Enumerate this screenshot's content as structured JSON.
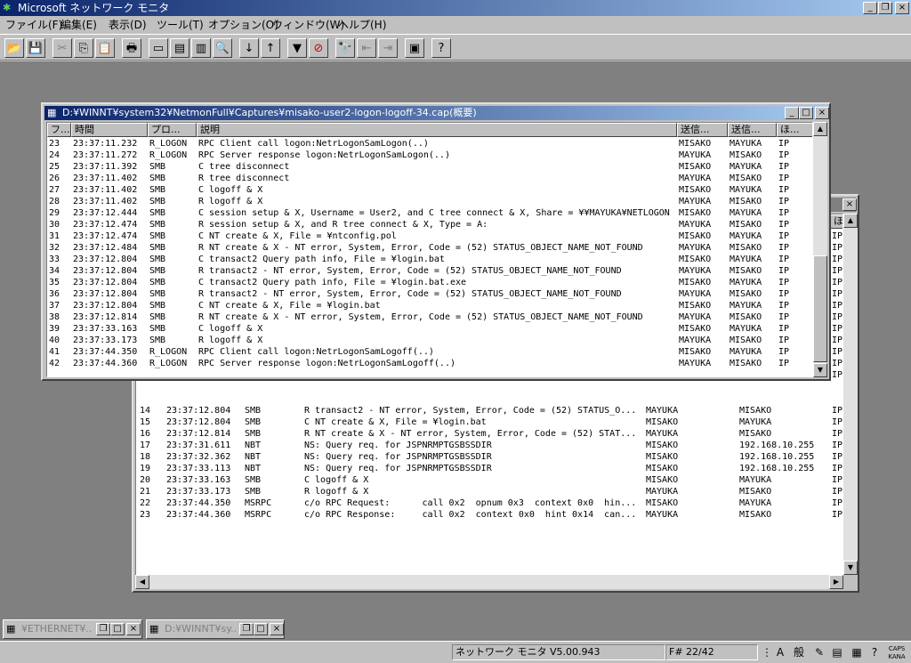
{
  "app": {
    "title": "Microsoft ネットワーク モニタ",
    "icon": "netmon-icon",
    "window_controls": [
      "_",
      "❐",
      "×"
    ]
  },
  "menu": [
    "ファイル(F)",
    "編集(E)",
    "表示(D)",
    "ツール(T)",
    "オプション(O)",
    "ウィンドウ(W)",
    "ヘルプ(H)"
  ],
  "toolbar_glyphs": {
    "open": "📂",
    "save": "💾",
    "cut": "✂",
    "copy": "⎘",
    "paste": "📋",
    "print": "🖶",
    "pane1": "▭",
    "pane2": "▤",
    "pane3": "▥",
    "zoom": "🔍",
    "down": "↓",
    "up": "↑",
    "filter": "▼",
    "nofilter": "⊘",
    "find": "🔭",
    "findprev": "⇤",
    "findnext": "⇥",
    "window": "▣",
    "help": "?"
  },
  "colors": {
    "titlebar_active": "#0a246a",
    "titlebar_inactive": "#808080",
    "workspace": "#808080"
  },
  "front_window": {
    "title": "D:¥WINNT¥system32¥NetmonFull¥Captures¥misako-user2-logon-logoff-34.cap(概要)",
    "columns": [
      "フ...",
      "時間",
      "プロ...",
      "説明",
      "送信...",
      "送信...",
      "ほ..."
    ],
    "rows": [
      [
        "23",
        "23:37:11.232",
        "R_LOGON",
        "RPC Client call logon:NetrLogonSamLogon(..)",
        "MISAKO",
        "MAYUKA",
        "IP"
      ],
      [
        "24",
        "23:37:11.272",
        "R_LOGON",
        "RPC Server response logon:NetrLogonSamLogon(..)",
        "MAYUKA",
        "MISAKO",
        "IP"
      ],
      [
        "25",
        "23:37:11.392",
        "SMB",
        "C tree disconnect",
        "MISAKO",
        "MAYUKA",
        "IP"
      ],
      [
        "26",
        "23:37:11.402",
        "SMB",
        "R tree disconnect",
        "MAYUKA",
        "MISAKO",
        "IP"
      ],
      [
        "27",
        "23:37:11.402",
        "SMB",
        "C logoff & X",
        "MISAKO",
        "MAYUKA",
        "IP"
      ],
      [
        "28",
        "23:37:11.402",
        "SMB",
        "R logoff & X",
        "MAYUKA",
        "MISAKO",
        "IP"
      ],
      [
        "29",
        "23:37:12.444",
        "SMB",
        "C session setup & X, Username = User2, and C tree connect & X, Share = ¥¥MAYUKA¥NETLOGON",
        "MISAKO",
        "MAYUKA",
        "IP"
      ],
      [
        "30",
        "23:37:12.474",
        "SMB",
        "R session setup & X, and R tree connect & X, Type = A:",
        "MAYUKA",
        "MISAKO",
        "IP"
      ],
      [
        "31",
        "23:37:12.474",
        "SMB",
        "C NT create & X, File = ¥ntconfig.pol",
        "MISAKO",
        "MAYUKA",
        "IP"
      ],
      [
        "32",
        "23:37:12.484",
        "SMB",
        "R NT create & X - NT error, System, Error, Code = (52) STATUS_OBJECT_NAME_NOT_FOUND",
        "MAYUKA",
        "MISAKO",
        "IP"
      ],
      [
        "33",
        "23:37:12.804",
        "SMB",
        "C transact2 Query path info, File = ¥login.bat",
        "MISAKO",
        "MAYUKA",
        "IP"
      ],
      [
        "34",
        "23:37:12.804",
        "SMB",
        "R transact2 - NT error, System, Error, Code = (52) STATUS_OBJECT_NAME_NOT_FOUND",
        "MAYUKA",
        "MISAKO",
        "IP"
      ],
      [
        "35",
        "23:37:12.804",
        "SMB",
        "C transact2 Query path info, File = ¥login.bat.exe",
        "MISAKO",
        "MAYUKA",
        "IP"
      ],
      [
        "36",
        "23:37:12.804",
        "SMB",
        "R transact2 - NT error, System, Error, Code = (52) STATUS_OBJECT_NAME_NOT_FOUND",
        "MAYUKA",
        "MISAKO",
        "IP"
      ],
      [
        "37",
        "23:37:12.804",
        "SMB",
        "C NT create & X, File = ¥login.bat",
        "MISAKO",
        "MAYUKA",
        "IP"
      ],
      [
        "38",
        "23:37:12.814",
        "SMB",
        "R NT create & X - NT error, System, Error, Code = (52) STATUS_OBJECT_NAME_NOT_FOUND",
        "MAYUKA",
        "MISAKO",
        "IP"
      ],
      [
        "39",
        "23:37:33.163",
        "SMB",
        "C logoff & X",
        "MISAKO",
        "MAYUKA",
        "IP"
      ],
      [
        "40",
        "23:37:33.173",
        "SMB",
        "R logoff & X",
        "MAYUKA",
        "MISAKO",
        "IP"
      ],
      [
        "41",
        "23:37:44.350",
        "R_LOGON",
        "RPC Client call logon:NetrLogonSamLogoff(..)",
        "MISAKO",
        "MAYUKA",
        "IP"
      ],
      [
        "42",
        "23:37:44.360",
        "R_LOGON",
        "RPC Server response logon:NetrLogonSamLogoff(..)",
        "MAYUKA",
        "MISAKO",
        "IP"
      ]
    ]
  },
  "back_window": {
    "header_partial": "ほ",
    "right_edge_cells": [
      "IP",
      "IP",
      "IP",
      "IP",
      "IP",
      "IP",
      "IP",
      "IP",
      "IP",
      "IP",
      "IP",
      "IP",
      "IP"
    ],
    "rows": [
      [
        "14",
        "23:37:12.804",
        "SMB",
        "R transact2 - NT error, System, Error, Code = (52) STATUS_O...",
        "MAYUKA",
        "MISAKO",
        "IP"
      ],
      [
        "15",
        "23:37:12.804",
        "SMB",
        "C NT create & X, File = ¥login.bat",
        "MISAKO",
        "MAYUKA",
        "IP"
      ],
      [
        "16",
        "23:37:12.814",
        "SMB",
        "R NT create & X - NT error, System, Error, Code = (52) STAT...",
        "MAYUKA",
        "MISAKO",
        "IP"
      ],
      [
        "17",
        "23:37:31.611",
        "NBT",
        "NS: Query req. for JSPNRMPTGSBSSDIR",
        "MISAKO",
        "192.168.10.255",
        "IP"
      ],
      [
        "18",
        "23:37:32.362",
        "NBT",
        "NS: Query req. for JSPNRMPTGSBSSDIR",
        "MISAKO",
        "192.168.10.255",
        "IP"
      ],
      [
        "19",
        "23:37:33.113",
        "NBT",
        "NS: Query req. for JSPNRMPTGSBSSDIR",
        "MISAKO",
        "192.168.10.255",
        "IP"
      ],
      [
        "20",
        "23:37:33.163",
        "SMB",
        "C logoff & X",
        "MISAKO",
        "MAYUKA",
        "IP"
      ],
      [
        "21",
        "23:37:33.173",
        "SMB",
        "R logoff & X",
        "MAYUKA",
        "MISAKO",
        "IP"
      ],
      [
        "22",
        "23:37:44.350",
        "MSRPC",
        "c/o RPC Request:      call 0x2  opnum 0x3  context 0x0  hin...",
        "MISAKO",
        "MAYUKA",
        "IP"
      ],
      [
        "23",
        "23:37:44.360",
        "MSRPC",
        "c/o RPC Response:     call 0x2  context 0x0  hint 0x14  can...",
        "MAYUKA",
        "MISAKO",
        "IP"
      ]
    ]
  },
  "minimized": [
    {
      "title": "¥ETHERNET¥..."
    },
    {
      "title": "D:¥WINNT¥sy..."
    }
  ],
  "status": {
    "version": "ネットワーク モニタ V5.00.943",
    "frame": "F# 22/42",
    "ime_mode": "般",
    "ime_a": "A",
    "caps": "CAPS",
    "kana": "KANA"
  }
}
